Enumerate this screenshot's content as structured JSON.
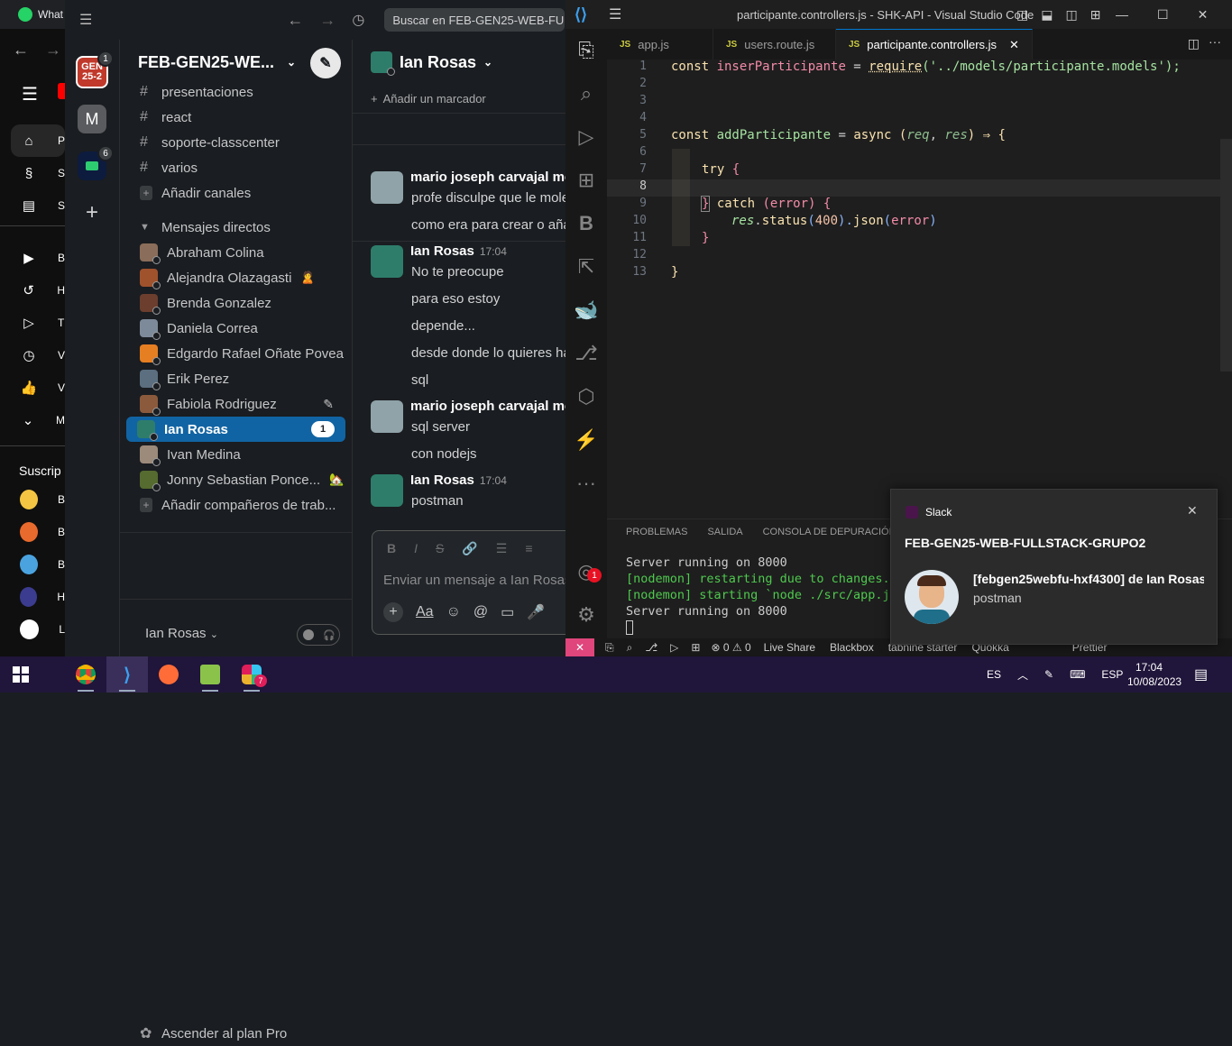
{
  "youtube": {
    "tab_title": "What",
    "nav_items": [
      {
        "icon": "home-icon",
        "label": "P"
      },
      {
        "icon": "shorts-icon",
        "label": "S"
      },
      {
        "icon": "subscriptions-icon",
        "label": "S"
      }
    ],
    "library_items": [
      {
        "icon": "library-icon",
        "label": "B"
      },
      {
        "icon": "history-icon",
        "label": "H"
      },
      {
        "icon": "your-videos-icon",
        "label": "T"
      },
      {
        "icon": "watch-later-icon",
        "label": "V"
      },
      {
        "icon": "liked-icon",
        "label": "V"
      },
      {
        "icon": "chevron-down-icon",
        "label": "M"
      }
    ],
    "subs_title": "Suscrip",
    "subs": [
      {
        "label": "B",
        "color": "#f4c542"
      },
      {
        "label": "B",
        "color": "#e86a2c"
      },
      {
        "label": "B",
        "color": "#4aa3df"
      },
      {
        "label": "H",
        "color": "#3b3b8f"
      },
      {
        "label": "L",
        "color": "#ffffff"
      }
    ]
  },
  "slack": {
    "search_placeholder": "Buscar en FEB-GEN25-WEB-FU",
    "workspace_name": "FEB-GEN25-WE...",
    "workspaces": [
      {
        "label": "GEN 25-2",
        "badge": "1",
        "color": "#c0392b"
      },
      {
        "label": "M",
        "badge": "",
        "color": "#5a5b5e"
      },
      {
        "label": "",
        "badge": "6",
        "color": "#0d1b3e"
      }
    ],
    "channels": [
      "presentaciones",
      "react",
      "soporte-classcenter",
      "varios"
    ],
    "add_channels": "Añadir canales",
    "dm_header": "Mensajes directos",
    "dms": [
      {
        "name": "Abraham Colina",
        "extra": ""
      },
      {
        "name": "Alejandra Olazagasti",
        "extra": "🙎"
      },
      {
        "name": "Brenda Gonzalez",
        "extra": ""
      },
      {
        "name": "Daniela Correa",
        "extra": ""
      },
      {
        "name": "Edgardo Rafael Oñate Povea",
        "extra": ""
      },
      {
        "name": "Erik Perez",
        "extra": ""
      },
      {
        "name": "Fabiola Rodriguez",
        "extra": "✎"
      },
      {
        "name": "Ian Rosas",
        "extra": "",
        "count": "1"
      },
      {
        "name": "Ivan Medina",
        "extra": ""
      },
      {
        "name": "Jonny Sebastian Ponce...",
        "extra": "🏡"
      }
    ],
    "add_coworkers": "Añadir compañeros de trab...",
    "upgrade": "Ascender al plan Pro",
    "user_name": "Ian Rosas",
    "chat_title": "Ian Rosas",
    "bookmark": "Añadir un marcador",
    "messages": [
      {
        "author": "mario joseph carvajal mel",
        "time": "",
        "lines": [
          "profe  disculpe que le mole",
          "como era para crear o aña"
        ]
      },
      {
        "author": "Ian Rosas",
        "time": "17:04",
        "lines": [
          "No te preocupe",
          "para eso estoy",
          "depende...",
          "desde donde lo quieres ha",
          "sql"
        ]
      },
      {
        "author": "mario joseph carvajal mel",
        "time": "",
        "lines": [
          "sql server",
          "con nodejs"
        ]
      },
      {
        "author": "Ian Rosas",
        "time": "17:04",
        "lines": [
          "postman"
        ]
      }
    ],
    "composer_placeholder": "Enviar un mensaje a Ian Rosas"
  },
  "vscode": {
    "title": "participante.controllers.js - SHK-API - Visual Studio Code",
    "tabs": [
      {
        "label": "app.js",
        "active": false
      },
      {
        "label": "users.route.js",
        "active": false
      },
      {
        "label": "participante.controllers.js",
        "active": true
      }
    ],
    "line_numbers": [
      "1",
      "2",
      "3",
      "4",
      "5",
      "6",
      "7",
      "8",
      "9",
      "10",
      "11",
      "12",
      "13"
    ],
    "code": {
      "l1": [
        "const ",
        "inserParticipante",
        " = ",
        "require",
        "('../models/participante.models');"
      ],
      "l5": [
        "const ",
        "addParticipante",
        " = ",
        "async",
        " (",
        "req",
        ", ",
        "res",
        ") ",
        "⇒",
        " {"
      ],
      "l7": [
        "try",
        " {"
      ],
      "l9": [
        "}",
        " catch ",
        "(",
        "error",
        ") {"
      ],
      "l10": [
        "res",
        ".",
        "status",
        "(",
        "400",
        ").",
        "json",
        "(",
        "error",
        ")"
      ],
      "l11": "}",
      "l13": "}"
    },
    "panel_tabs": [
      "PROBLEMAS",
      "SALIDA",
      "CONSOLA DE DEPURACIÓN"
    ],
    "terminal": [
      "Server running on 8000",
      "[nodemon] restarting due to changes...",
      "[nodemon] starting `node ./src/app.js`",
      "Server running on 8000"
    ],
    "status_items": [
      "⊗ 0 ⚠ 0",
      "Live Share",
      "Blackbox",
      "tabnine starter",
      "Quokka",
      "Prettier"
    ],
    "notification_badge": "1"
  },
  "toast": {
    "app": "Slack",
    "title": "FEB-GEN25-WEB-FULLSTACK-GRUPO2",
    "sender": "[febgen25webfu-hxf4300] de Ian Rosas",
    "body": "postman"
  },
  "taskbar": {
    "lang": "ES",
    "kbd": "ESP",
    "time": "17:04",
    "date": "10/08/2023",
    "slack_badge": "7"
  },
  "colors": {
    "keyword": "#ff9e64",
    "func_name": "#f38ba8",
    "string": "#a6e3a1",
    "yellow": "#f9e2af",
    "slack_selected": "#1164a3"
  }
}
